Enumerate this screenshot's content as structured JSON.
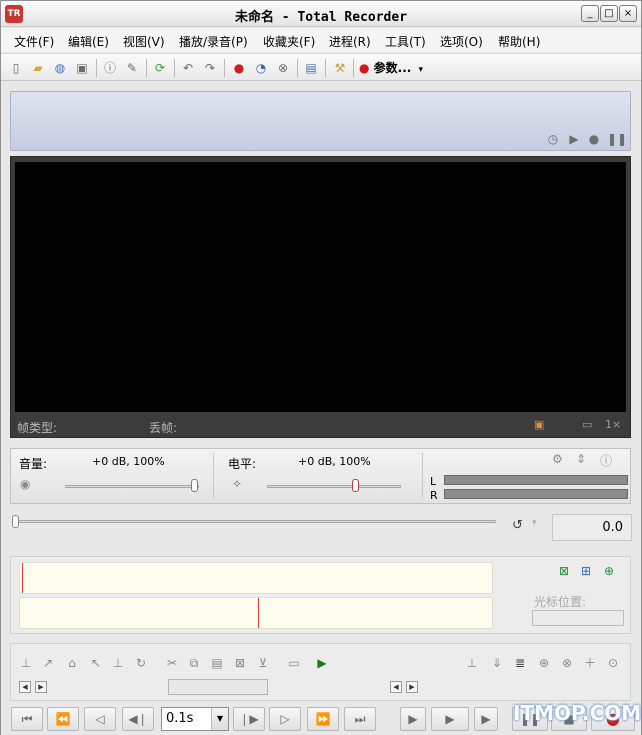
{
  "window": {
    "title": "未命名 - Total Recorder",
    "app_icon_text": "TR",
    "min": "_",
    "max": "□",
    "close": "×"
  },
  "menu": [
    "文件(F)",
    "编辑(E)",
    "视图(V)",
    "播放/录音(P)",
    "收藏夹(F)",
    "进程(R)",
    "工具(T)",
    "选项(O)",
    "帮助(H)"
  ],
  "toolbar": {
    "params_label": "参数...",
    "params_arrow": "▾"
  },
  "status": {},
  "video": {
    "frame_type_label": "帧类型:",
    "dropped_frames_label": "丢帧:",
    "zoom_label": "1×"
  },
  "volume": {
    "label": "音量:",
    "value": "+0 dB, 100%"
  },
  "level": {
    "label": "电平:",
    "value": "+0 dB, 100%",
    "meter_left": "L",
    "meter_right": "R"
  },
  "position": {
    "value": "0.0"
  },
  "cursor": {
    "label": "光标位置:"
  },
  "transport": {
    "step_value": "0.1s"
  },
  "watermark": "ITMOP.COM",
  "colors": {
    "video_bg": "#000000",
    "status_panel": "#c6cde0",
    "record_red": "#d01818",
    "cursor_red": "#d04040"
  }
}
